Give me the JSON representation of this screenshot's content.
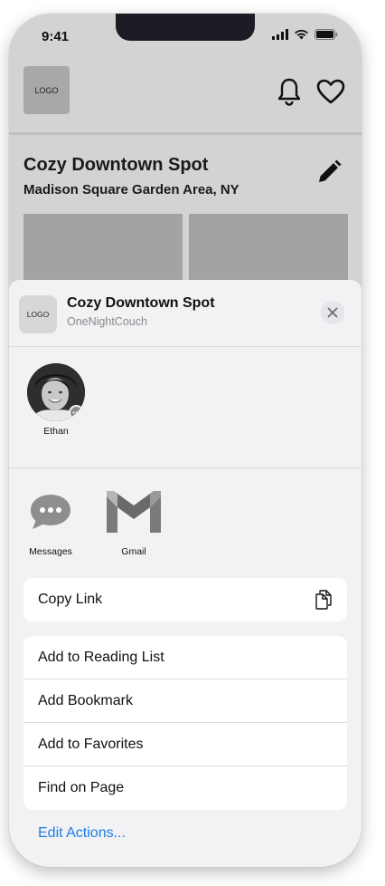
{
  "status_bar": {
    "time": "9:41"
  },
  "header": {
    "logo_text": "LOGO"
  },
  "listing": {
    "title": "Cozy Downtown Spot",
    "subtitle": "Madison Square Garden Area, NY"
  },
  "share_sheet": {
    "logo_text": "LOGO",
    "title": "Cozy Downtown Spot",
    "source": "OneNightCouch",
    "contacts": [
      {
        "name": "Ethan"
      }
    ],
    "apps": [
      {
        "label": "Messages",
        "icon": "messages-icon"
      },
      {
        "label": "Gmail",
        "icon": "gmail-icon"
      }
    ],
    "copy_link": "Copy Link",
    "actions": [
      "Add to Reading List",
      "Add Bookmark",
      "Add to Favorites",
      "Find on Page"
    ],
    "edit_actions": "Edit Actions..."
  },
  "colors": {
    "link_blue": "#1a7ce6",
    "sheet_bg": "#f2f2f4",
    "backdrop": "#d3d3d3"
  }
}
